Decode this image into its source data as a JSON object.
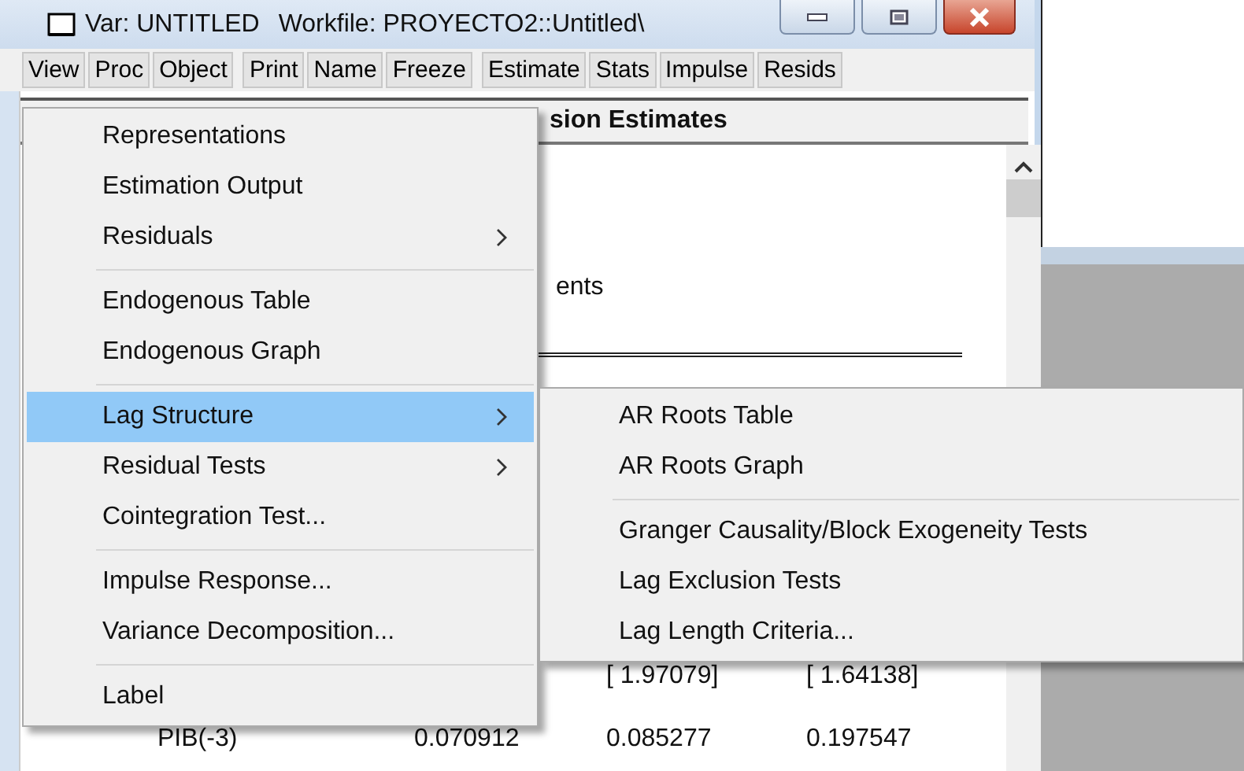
{
  "window": {
    "title": "Var: UNTITLED",
    "workfile": "Workfile: PROYECTO2::Untitled\\"
  },
  "toolbar": [
    [
      {
        "label": "View"
      },
      {
        "label": "Proc"
      },
      {
        "label": "Object"
      }
    ],
    [
      {
        "label": "Print"
      },
      {
        "label": "Name"
      },
      {
        "label": "Freeze"
      }
    ],
    [
      {
        "label": "Estimate"
      },
      {
        "label": "Stats"
      },
      {
        "label": "Impulse"
      },
      {
        "label": "Resids"
      }
    ]
  ],
  "output": {
    "header": "sion Estimates",
    "note": "ents",
    "rows": [
      {
        "cells": [
          "",
          "",
          "[ 1.97079]",
          "[ 1.64138]"
        ]
      },
      {
        "cells": [
          "PIB(-3)",
          "0.070912",
          "0.085277",
          "0.197547"
        ]
      }
    ]
  },
  "menu": [
    {
      "kind": "item",
      "label": "Representations",
      "submenu": false,
      "selected": false
    },
    {
      "kind": "item",
      "label": "Estimation Output",
      "submenu": false,
      "selected": false
    },
    {
      "kind": "item",
      "label": "Residuals",
      "submenu": true,
      "selected": false
    },
    {
      "kind": "separator"
    },
    {
      "kind": "item",
      "label": "Endogenous Table",
      "submenu": false,
      "selected": false
    },
    {
      "kind": "item",
      "label": "Endogenous Graph",
      "submenu": false,
      "selected": false
    },
    {
      "kind": "separator"
    },
    {
      "kind": "item",
      "label": "Lag Structure",
      "submenu": true,
      "selected": true
    },
    {
      "kind": "item",
      "label": "Residual Tests",
      "submenu": true,
      "selected": false
    },
    {
      "kind": "item",
      "label": "Cointegration Test...",
      "submenu": false,
      "selected": false
    },
    {
      "kind": "separator"
    },
    {
      "kind": "item",
      "label": "Impulse Response...",
      "submenu": false,
      "selected": false
    },
    {
      "kind": "item",
      "label": "Variance Decomposition...",
      "submenu": false,
      "selected": false
    },
    {
      "kind": "separator"
    },
    {
      "kind": "item",
      "label": "Label",
      "submenu": false,
      "selected": false
    }
  ],
  "submenu": [
    {
      "kind": "item",
      "label": "AR Roots Table",
      "selected": false
    },
    {
      "kind": "item",
      "label": "AR Roots Graph",
      "selected": false
    },
    {
      "kind": "separator"
    },
    {
      "kind": "item",
      "label": "Granger Causality/Block Exogeneity Tests",
      "selected": false
    },
    {
      "kind": "item",
      "label": "Lag Exclusion Tests",
      "selected": false
    },
    {
      "kind": "item",
      "label": "Lag Length Criteria...",
      "selected": false
    }
  ]
}
